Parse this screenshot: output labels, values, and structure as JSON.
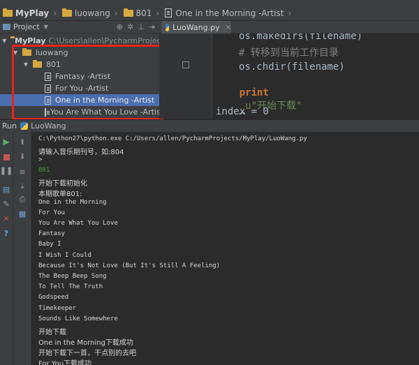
{
  "navbar": {
    "project": "MyPlay",
    "folder": "luowang",
    "subfolder": "801",
    "file": "One in the Morning -Artist"
  },
  "project_panel": {
    "title": "Project",
    "tree": [
      {
        "label": "MyPlay",
        "path": "C:\\Users\\allen\\PycharmProjects\\M"
      },
      {
        "label": "luowang"
      },
      {
        "label": "801"
      },
      {
        "label": "Fantasy -Artist"
      },
      {
        "label": "For You -Artist"
      },
      {
        "label": "One in the Morning -Artist",
        "selected": true
      },
      {
        "label": "You Are What You Love -Artist"
      }
    ]
  },
  "editor": {
    "tab_label": "LuoWang.py",
    "lines": [
      {
        "kind": "plain",
        "text": "os.makedirs(filename)"
      },
      {
        "kind": "comment",
        "text": "# 转移到当前工作目录"
      },
      {
        "kind": "plain",
        "text": "os.chdir(filename)"
      },
      {
        "kind": "print",
        "keyword": "print",
        "text": "u\"开始下载\""
      },
      {
        "kind": "plain",
        "text": "index = 0"
      }
    ]
  },
  "run_panel": {
    "run_label": "Run",
    "config_name": "LuoWang",
    "console_lines": [
      "C:\\Python27\\python.exe C:/Users/allen/PycharmProjects/MyPlay/LuoWang.py",
      "请输入音乐期刊号，如:804",
      ">",
      "801",
      "开始下载初始化",
      "本期歌单801:",
      "One in the Morning",
      "For You",
      "You Are What You Love",
      "Fantasy",
      "Baby I",
      "I Wish I Could",
      "Because It's Not Love (But It's Still A Feeling)",
      "The Beep Beep Song",
      "To Tell The Truth",
      "Godspeed",
      "Timekeeper",
      "Sounds Like Somewhere",
      "开始下载",
      "One in the Morning下载成功",
      "开始下载下一首，干点别的去吧",
      "For You下载成功"
    ]
  },
  "colors": {
    "selection": "#4b6eaf",
    "highlight_box": "#e8231c",
    "keyword": "#cc7832",
    "string": "#6a8759",
    "input_echo": "#4e9a3e"
  }
}
